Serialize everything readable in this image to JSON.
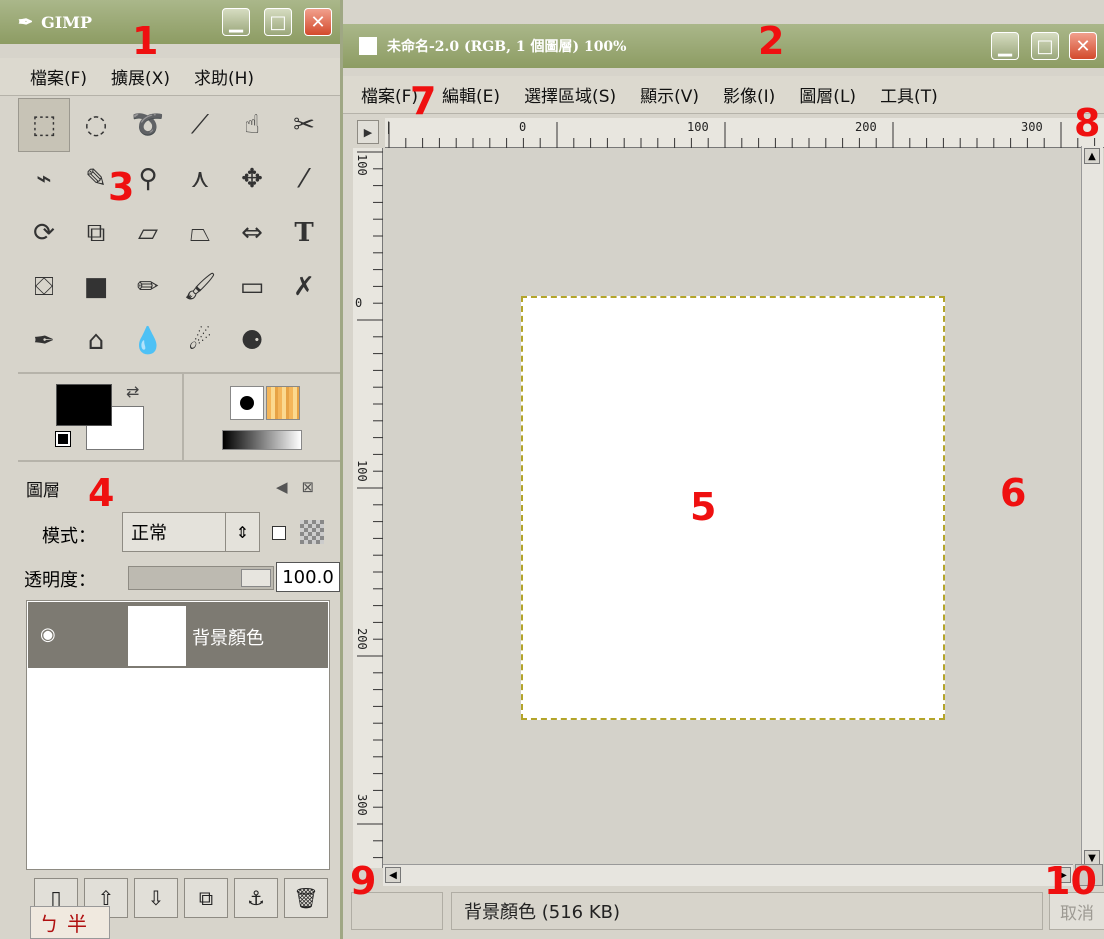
{
  "toolbox": {
    "title": "GIMP",
    "menu": [
      "檔案(F)",
      "擴展(X)",
      "求助(H)"
    ],
    "tools": [
      {
        "name": "rect-select-icon",
        "glyph": "⬚"
      },
      {
        "name": "ellipse-select-icon",
        "glyph": "◌"
      },
      {
        "name": "lasso-icon",
        "glyph": "➰"
      },
      {
        "name": "magic-wand-icon",
        "glyph": "⟋"
      },
      {
        "name": "select-by-color-icon",
        "glyph": "☝"
      },
      {
        "name": "scissors-select-icon",
        "glyph": "✂"
      },
      {
        "name": "paths-icon",
        "glyph": "⌁"
      },
      {
        "name": "color-picker-icon",
        "glyph": "✎"
      },
      {
        "name": "zoom-icon",
        "glyph": "⚲"
      },
      {
        "name": "measure-icon",
        "glyph": "⋏"
      },
      {
        "name": "move-icon",
        "glyph": "✥"
      },
      {
        "name": "crop-icon",
        "glyph": "⁄"
      },
      {
        "name": "rotate-icon",
        "glyph": "⟳"
      },
      {
        "name": "scale-icon",
        "glyph": "⧉"
      },
      {
        "name": "shear-icon",
        "glyph": "▱"
      },
      {
        "name": "perspective-icon",
        "glyph": "⏢"
      },
      {
        "name": "flip-icon",
        "glyph": "⇔"
      },
      {
        "name": "text-icon",
        "glyph": "T"
      },
      {
        "name": "bucket-fill-icon",
        "glyph": "⛋"
      },
      {
        "name": "blend-icon",
        "glyph": "■"
      },
      {
        "name": "pencil-icon",
        "glyph": "✏"
      },
      {
        "name": "paintbrush-icon",
        "glyph": "🖌"
      },
      {
        "name": "eraser-icon",
        "glyph": "▭"
      },
      {
        "name": "airbrush-icon",
        "glyph": "✗"
      },
      {
        "name": "ink-icon",
        "glyph": "✒"
      },
      {
        "name": "clone-icon",
        "glyph": "⌂"
      },
      {
        "name": "blur-icon",
        "glyph": "💧"
      },
      {
        "name": "smudge-icon",
        "glyph": "☄"
      },
      {
        "name": "dodge-burn-icon",
        "glyph": "⚈"
      }
    ]
  },
  "layers_dock": {
    "title": "圖層",
    "mode_label": "模式：",
    "mode_value": "正常",
    "opacity_label": "透明度：",
    "opacity_value": "100.0",
    "layers": [
      {
        "name": "背景顏色"
      }
    ],
    "ime": [
      "ㄅ",
      "半"
    ]
  },
  "image_window": {
    "title": "未命名-2.0 (RGB, 1 個圖層) 100%",
    "menu": [
      "檔案(F)",
      "編輯(E)",
      "選擇區域(S)",
      "顯示(V)",
      "影像(I)",
      "圖層(L)",
      "工具(T)"
    ],
    "ruler_top_labels": [
      "0",
      "100",
      "200",
      "300"
    ],
    "ruler_left_labels": [
      "100",
      "0",
      "100",
      "200",
      "300"
    ],
    "status_text": "背景顏色 (516 KB)",
    "cancel_label": "取消"
  },
  "annotations": [
    "1",
    "2",
    "3",
    "4",
    "5",
    "6",
    "7",
    "8",
    "9",
    "10"
  ],
  "colors": {
    "titlebar": "#97a56e",
    "close": "#d34a2c",
    "annotation": "#ef1010",
    "selection": "#b3a42a"
  }
}
